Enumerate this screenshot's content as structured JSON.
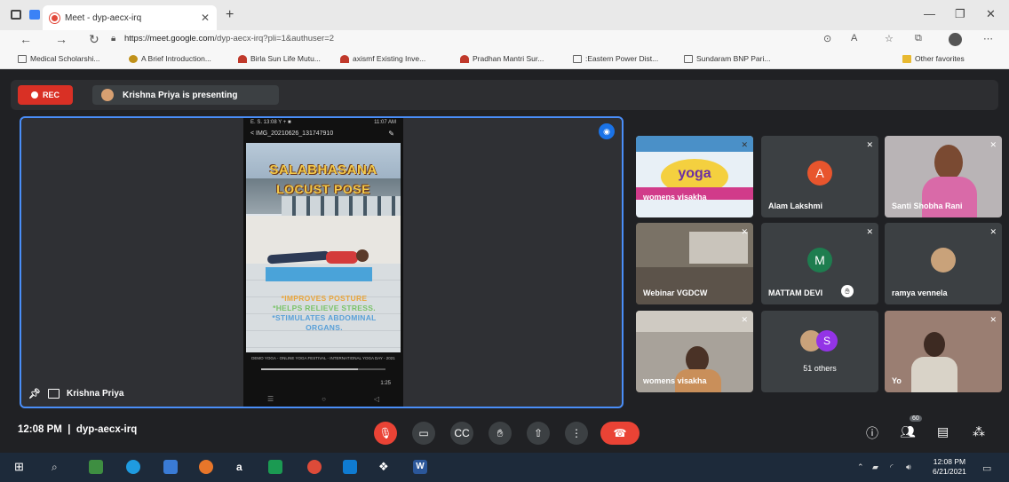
{
  "browser": {
    "tab_title": "Meet - dyp-aecx-irq",
    "url_domain": "https://meet.google.com",
    "url_path": "/dyp-aecx-irq?pli=1&authuser=2",
    "favorites": [
      "Medical Scholarshi...",
      "A Brief Introduction...",
      "Birla Sun Life Mutu...",
      "axismf Existing Inve...",
      "Pradhan Mantri Sur...",
      ":Eastern Power Dist...",
      "Sundaram BNP Pari...",
      "Other favorites"
    ]
  },
  "meet": {
    "rec_label": "REC",
    "presenting_banner": "Krishna Priya is presenting",
    "presenter_name": "Krishna Priya",
    "phone": {
      "status_left": "E. S. 13:08 Y + ■",
      "status_right": "11:07 AM",
      "file_title": "< IMG_20210626_131747910",
      "poster_title_1": "SALABHASANA",
      "poster_title_2": "LOCUST POSE",
      "benefit_1": "*IMPROVES POSTURE",
      "benefit_2": "*HELPS RELIEVE STRESS.",
      "benefit_3": "*STIMULATES ABDOMINAL ORGANS.",
      "footer_text": "DEMO YOGA - ONLINE YOGA FESTIVAL - INTERNATIONAL YOGA DAY - 2021",
      "video_time": "1:25",
      "progress": 0.78
    },
    "participants": [
      {
        "name": "womens visakha",
        "kind": "poster"
      },
      {
        "name": "Alam Lakshmi",
        "kind": "letter",
        "letter": "A",
        "color": "#e8552d"
      },
      {
        "name": "Santi Shobha Rani",
        "kind": "photo"
      },
      {
        "name": "Webinar VGDCW",
        "kind": "photo"
      },
      {
        "name": "MATTAM DEVI",
        "kind": "letter",
        "letter": "M",
        "color": "#1e7d4f"
      },
      {
        "name": "ramya vennela",
        "kind": "avatar"
      },
      {
        "name": "womens visakha",
        "kind": "photo"
      },
      {
        "name": "51 others",
        "kind": "others",
        "letter": "S",
        "color": "#9334e6"
      },
      {
        "name": "Yo",
        "kind": "photo"
      }
    ],
    "poster_tile_text": "yoga",
    "time": "12:08 PM",
    "meeting_code": "dyp-aecx-irq",
    "people_count": "60"
  },
  "taskbar": {
    "clock_time": "12:08 PM",
    "clock_date": "6/21/2021"
  }
}
